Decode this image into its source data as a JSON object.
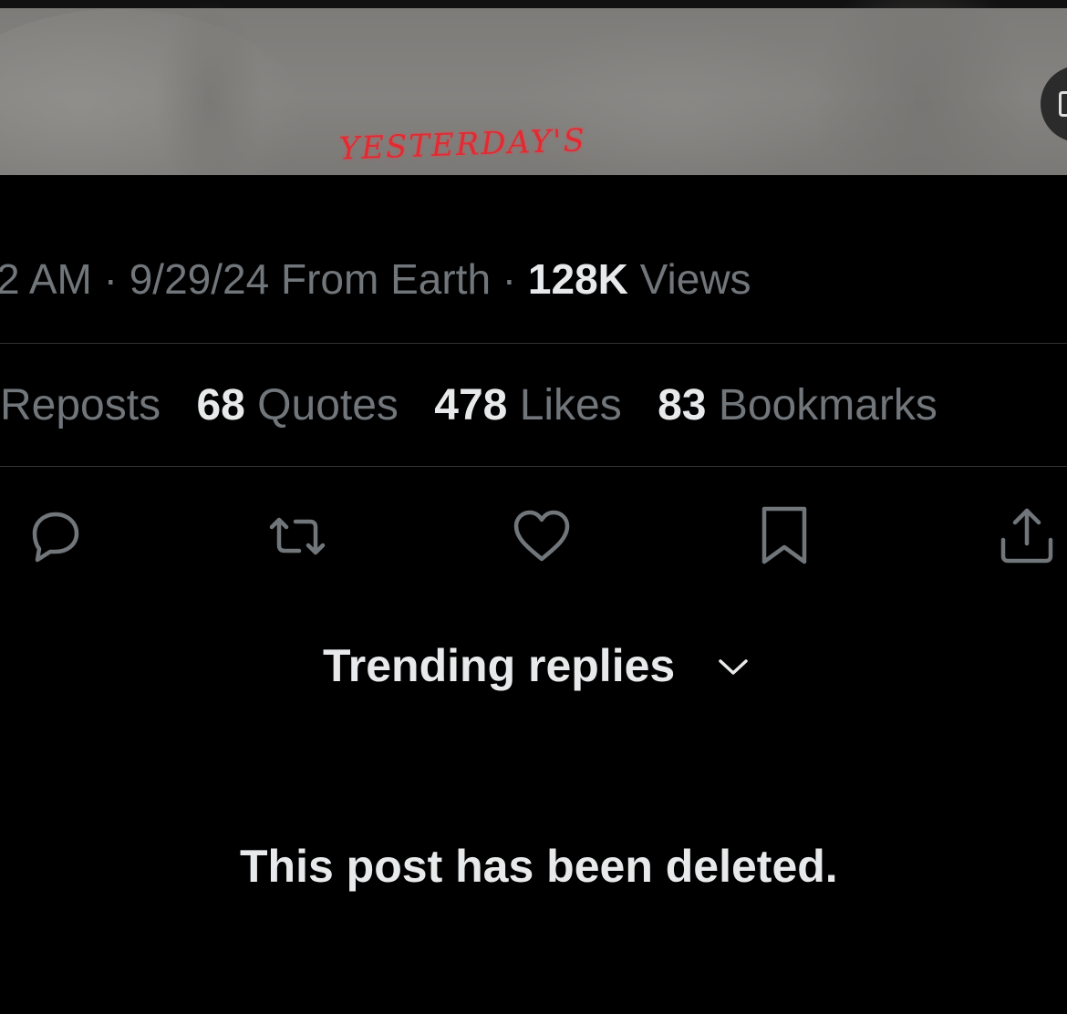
{
  "media": {
    "shirt_text": "YESTERDAY'S"
  },
  "meta": {
    "time": "2 AM",
    "sep1": " · ",
    "date": "9/29/24",
    "location": " From Earth",
    "sep2": " · ",
    "views_count": "128K",
    "views_label": " Views"
  },
  "stats": [
    {
      "count": "",
      "label": "Reposts"
    },
    {
      "count": "68",
      "label": " Quotes"
    },
    {
      "count": "478",
      "label": " Likes"
    },
    {
      "count": "83",
      "label": " Bookmarks"
    }
  ],
  "actions": [
    {
      "name": "reply",
      "icon": "reply-bubble-icon"
    },
    {
      "name": "repost",
      "icon": "repost-arrows-icon"
    },
    {
      "name": "like",
      "icon": "heart-icon"
    },
    {
      "name": "bookmark",
      "icon": "bookmark-icon"
    },
    {
      "name": "share",
      "icon": "share-upload-icon"
    }
  ],
  "replies": {
    "sort_label": "Trending replies",
    "deleted_notice": "This post has been deleted."
  },
  "colors": {
    "background": "#000000",
    "primary_text": "#e7e9ea",
    "secondary_text": "#71767b",
    "divider": "#2f3336",
    "logo_red": "#e22a33"
  }
}
